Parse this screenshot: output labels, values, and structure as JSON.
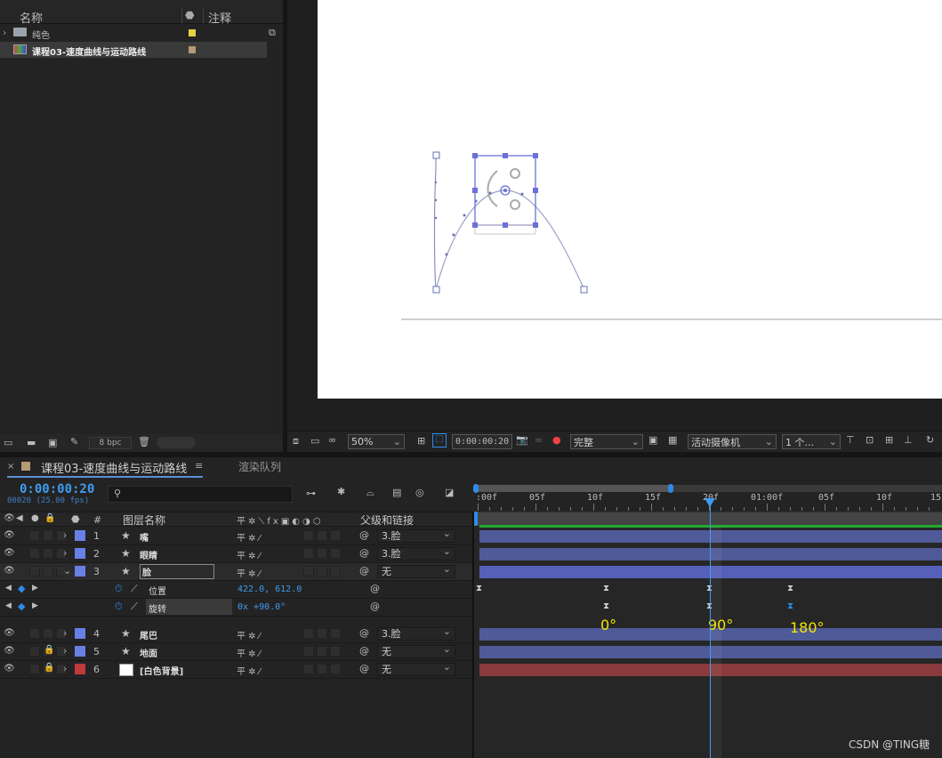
{
  "project": {
    "headers": [
      "名称",
      "注释"
    ],
    "items": [
      {
        "name": "纯色",
        "color": "#e7cf44",
        "type": "folder"
      },
      {
        "name": "课程03-速度曲线与运动路线",
        "color": "#b59a75",
        "type": "comp"
      }
    ],
    "bpc": "8 bpc"
  },
  "viewer": {
    "zoom": "50%",
    "timecode": "0:00:00:20",
    "resolution": "完整",
    "camera": "活动摄像机",
    "views": "1 个..."
  },
  "timeline": {
    "comp_tab": "课程03-速度曲线与运动路线",
    "queue_tab": "渲染队列",
    "current_time": "0:00:00:20",
    "frame_info": "00020 (25.00 fps)",
    "search_placeholder": "",
    "col_num": "#",
    "col_name": "图层名称",
    "col_parent": "父级和链接",
    "ruler": [
      ":00f",
      "05f",
      "10f",
      "15f",
      "20f",
      "01:00f",
      "05f",
      "10f",
      "15"
    ],
    "layers": [
      {
        "num": "1",
        "name": "嘴",
        "color": "#6a7fe6",
        "parent": "3.脸",
        "locked": false
      },
      {
        "num": "2",
        "name": "眼睛",
        "color": "#6a7fe6",
        "parent": "3.脸",
        "locked": false
      },
      {
        "num": "3",
        "name": "脸",
        "color": "#6a7fe6",
        "parent": "无",
        "locked": false
      },
      {
        "num": "4",
        "name": "尾巴",
        "color": "#6a7fe6",
        "parent": "3.脸",
        "locked": false
      },
      {
        "num": "5",
        "name": "地面",
        "color": "#6a7fe6",
        "parent": "无",
        "locked": true
      },
      {
        "num": "6",
        "name": "[白色背景]",
        "color": "#c03a3a",
        "parent": "无",
        "locked": true
      }
    ],
    "properties": [
      {
        "name": "位置",
        "value": "422.0, 612.0"
      },
      {
        "name": "旋转",
        "value": "0x +90.0°"
      }
    ],
    "annotations": [
      "0°",
      "90°",
      "180°"
    ]
  },
  "watermark": "CSDN @TING糖"
}
